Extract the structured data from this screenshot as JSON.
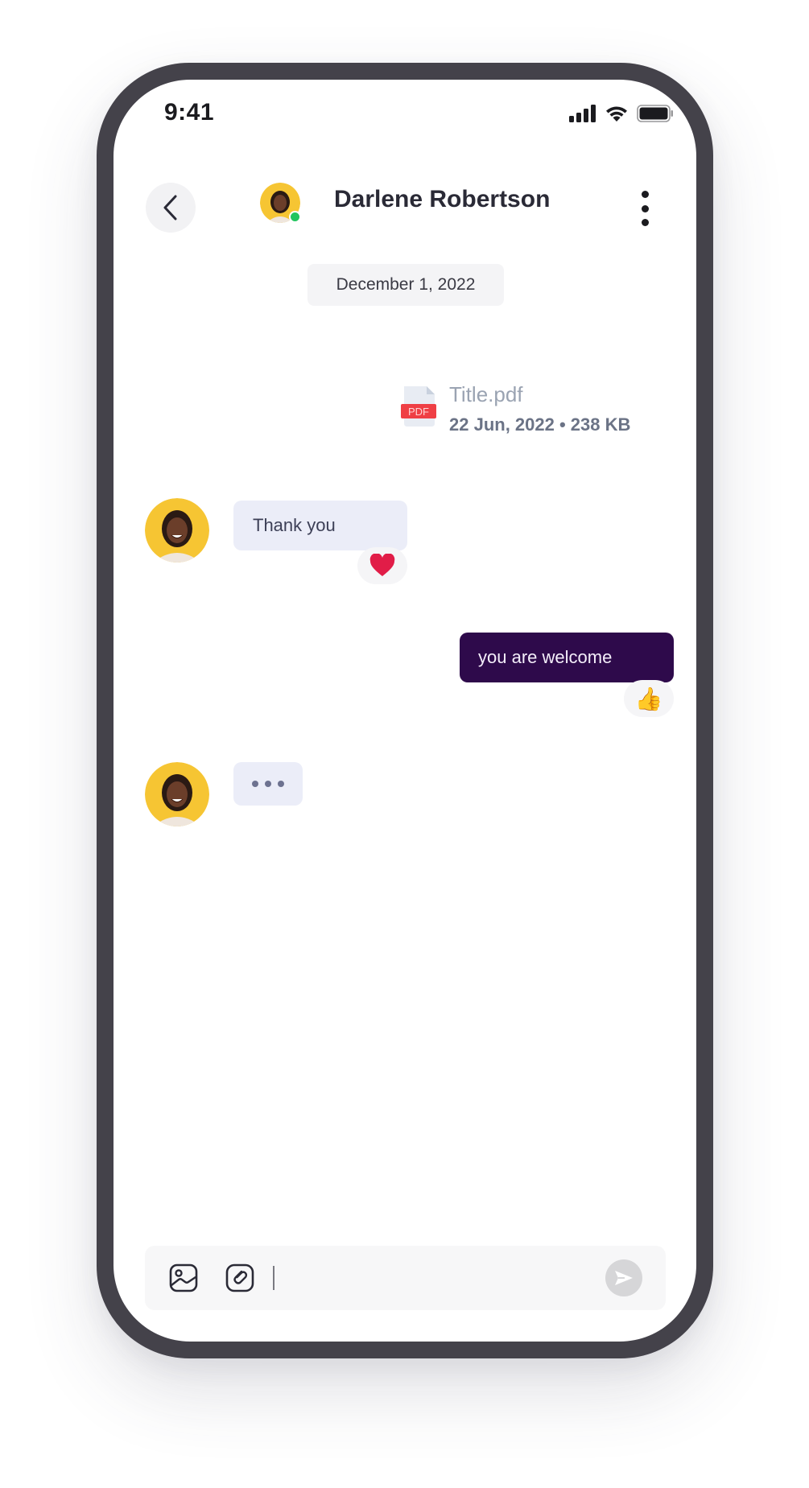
{
  "status_bar": {
    "time": "9:41",
    "icons": [
      "signal-icon",
      "wifi-icon",
      "battery-icon"
    ]
  },
  "header": {
    "back_icon": "chevron-left-icon",
    "contact_name": "Darlene Robertson",
    "online": true,
    "menu_icon": "more-vertical-icon"
  },
  "chat": {
    "date_label": "December 1, 2022",
    "messages": [
      {
        "type": "file",
        "direction": "outgoing",
        "file_badge": "PDF",
        "file_name": "Title.pdf",
        "file_meta": "22 Jun, 2022 • 238 KB"
      },
      {
        "type": "text",
        "direction": "incoming",
        "text": "Thank you",
        "reaction": "❤"
      },
      {
        "type": "text",
        "direction": "outgoing",
        "text": "you are welcome",
        "reaction": "👍"
      },
      {
        "type": "typing",
        "direction": "incoming"
      }
    ]
  },
  "composer": {
    "value": "",
    "placeholder": "",
    "gallery_icon": "image-icon",
    "attach_icon": "attachment-icon",
    "send_icon": "send-icon"
  },
  "colors": {
    "phone_frame": "#44424a",
    "outgoing_bubble": "#2e0a4b",
    "incoming_bubble": "#ebedf8",
    "online_dot": "#22c55e",
    "pdf_badge": "#ef3f45",
    "heart": "#e11d48"
  }
}
